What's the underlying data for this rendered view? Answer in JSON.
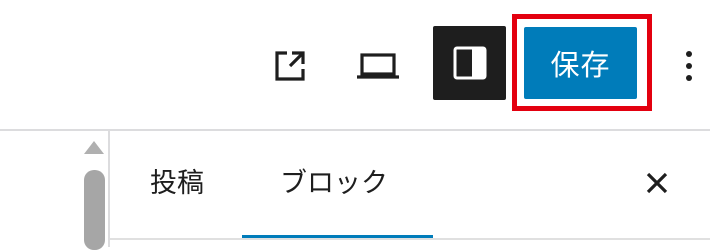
{
  "toolbar": {
    "view_icon": "external-link-icon",
    "preview_icon": "laptop-icon",
    "settings_icon": "sidebar-panel-icon",
    "save_label": "保存",
    "more_icon": "vertical-ellipsis-icon",
    "save_highlight_color": "#e3000f",
    "accent_color": "#007cba"
  },
  "sidebar": {
    "tabs": [
      {
        "label": "投稿",
        "active": false
      },
      {
        "label": "ブロック",
        "active": true
      }
    ],
    "close_icon": "close-icon"
  }
}
